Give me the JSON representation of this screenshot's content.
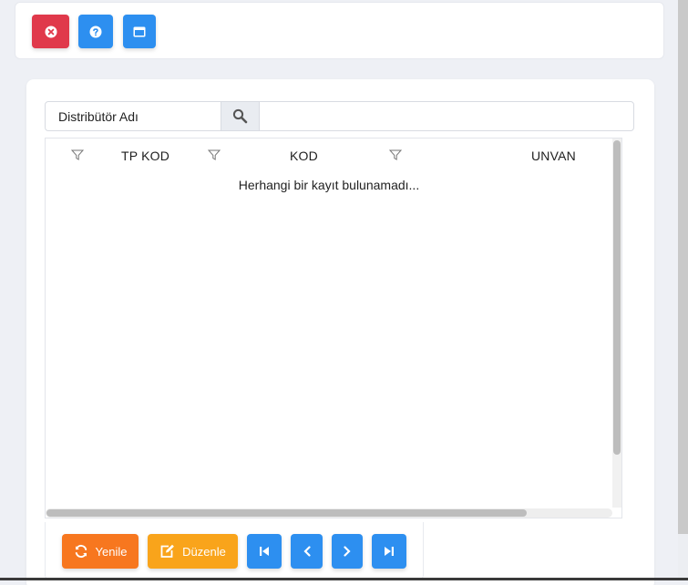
{
  "toolbar": {
    "close_icon": "close-circle-icon",
    "help_icon": "question-circle-icon",
    "window_icon": "window-icon",
    "colors": {
      "danger": "#e0394b",
      "primary": "#2d8ff0"
    }
  },
  "search": {
    "label": "Distribütör Adı",
    "input_value": "",
    "placeholder": ""
  },
  "grid": {
    "columns": [
      {
        "label": "TP KOD"
      },
      {
        "label": "KOD"
      },
      {
        "label": "UNVAN"
      }
    ],
    "empty_message": "Herhangi bir kayıt bulunamadı..."
  },
  "actions": {
    "refresh_label": "Yenile",
    "edit_label": "Düzenle",
    "colors": {
      "refresh": "#f7771f",
      "edit": "#f9a41b",
      "nav": "#2d8ff0"
    }
  }
}
